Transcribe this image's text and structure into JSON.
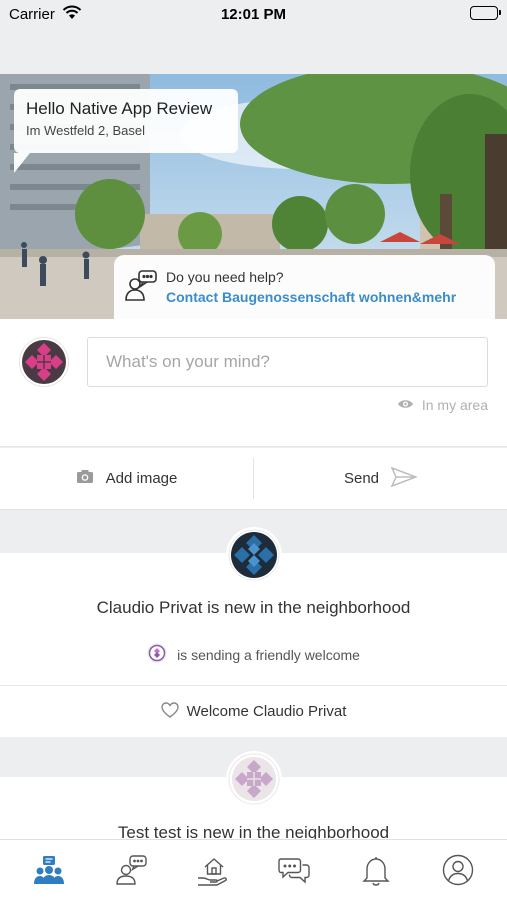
{
  "status_bar": {
    "carrier": "Carrier",
    "time": "12:01 PM"
  },
  "hero": {
    "greeting": "Hello Native App Review",
    "address": "Im Westfeld 2, Basel",
    "help_question": "Do you need help?",
    "help_link": "Contact Baugenossenschaft wohnen&mehr"
  },
  "composer": {
    "placeholder": "What's on your mind?",
    "value": "",
    "scope_label": "In my area",
    "add_image_label": "Add image",
    "send_label": "Send"
  },
  "feed": [
    {
      "title": "Claudio Privat is new in the neighborhood",
      "subtitle": "is sending a friendly welcome",
      "welcome_label": "Welcome Claudio Privat",
      "avatar_color": "#2b6fa8"
    },
    {
      "title": "Test test is new in the neighborhood",
      "avatar_color": "#c8a8c8"
    }
  ],
  "tabs": [
    {
      "icon": "neighbors-icon",
      "active": true
    },
    {
      "icon": "chat-bubble-person-icon",
      "active": false
    },
    {
      "icon": "house-hand-icon",
      "active": false
    },
    {
      "icon": "messages-icon",
      "active": false
    },
    {
      "icon": "bell-icon",
      "active": false
    },
    {
      "icon": "profile-icon",
      "active": false
    }
  ],
  "colors": {
    "accent": "#3a8dc8",
    "page_bg": "#eceef0",
    "avatar_pink": "#d93f87",
    "tab_inactive": "#555555"
  }
}
